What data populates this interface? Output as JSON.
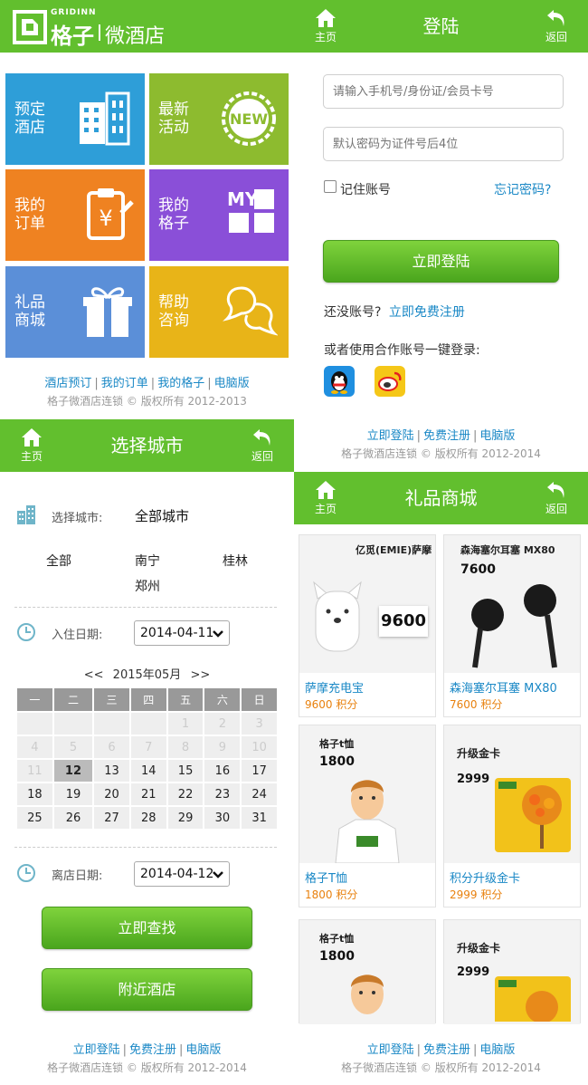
{
  "brand": {
    "logo_en": "GRIDINN",
    "logo_cn": "格子",
    "subtitle": "微酒店"
  },
  "colors": {
    "header": "#62bf2e",
    "link": "#1a88c6",
    "price": "#e8810e"
  },
  "home": {
    "tiles": [
      {
        "label": "预定酒店",
        "color": "#2e9ed8",
        "icon": "hotel-building-icon"
      },
      {
        "label": "最新活动",
        "color": "#8dbb2f",
        "icon": "new-badge-icon",
        "icon_text": "NEW"
      },
      {
        "label": "我的订单",
        "color": "#ef8221",
        "icon": "order-clipboard-icon"
      },
      {
        "label": "我的格子",
        "color": "#8a4fd8",
        "icon": "my-grid-icon",
        "icon_text": "MY"
      },
      {
        "label": "礼品商城",
        "color": "#5b8fd8",
        "icon": "gift-icon"
      },
      {
        "label": "帮助咨询",
        "color": "#e8b418",
        "icon": "chat-bubbles-icon"
      }
    ],
    "links": [
      "酒店预订",
      "我的订单",
      "我的格子",
      "电脑版"
    ],
    "copyright": "格子微酒店连锁 © 版权所有 2012-2013"
  },
  "login": {
    "nav": {
      "home": "主页",
      "title": "登陆",
      "back": "返回"
    },
    "username_placeholder": "请输入手机号/身份证/会员卡号",
    "password_placeholder": "默认密码为证件号后4位",
    "remember": "记住账号",
    "forgot": "忘记密码?",
    "submit": "立即登陆",
    "no_account": "还没账号?",
    "register": "立即免费注册",
    "partner": "或者使用合作账号一键登录:",
    "links": [
      "立即登陆",
      "免费注册",
      "电脑版"
    ],
    "copyright": "格子微酒店连锁 © 版权所有 2012-2014"
  },
  "city": {
    "nav": {
      "home": "主页",
      "title": "选择城市",
      "back": "返回"
    },
    "select_label": "选择城市:",
    "selected": "全部城市",
    "options": [
      "全部",
      "南宁",
      "桂林",
      "郑州"
    ],
    "checkin_label": "入住日期:",
    "checkin": "2014-04-11",
    "month": "2015年05月",
    "prev": "<<",
    "next": ">>",
    "weekdays": [
      "一",
      "二",
      "三",
      "四",
      "五",
      "六",
      "日"
    ],
    "weeks": [
      [
        "",
        "",
        "",
        "",
        "1",
        "2",
        "3"
      ],
      [
        "4",
        "5",
        "6",
        "7",
        "8",
        "9",
        "10"
      ],
      [
        "11",
        "12",
        "13",
        "14",
        "15",
        "16",
        "17"
      ],
      [
        "18",
        "19",
        "20",
        "21",
        "22",
        "23",
        "24"
      ],
      [
        "25",
        "26",
        "27",
        "28",
        "29",
        "30",
        "31"
      ]
    ],
    "today": "12",
    "checkout_label": "离店日期:",
    "checkout": "2014-04-12",
    "search": "立即查找",
    "nearby": "附近酒店",
    "links": [
      "立即登陆",
      "免费注册",
      "电脑版"
    ],
    "copyright": "格子微酒店连锁 © 版权所有 2012-2014"
  },
  "mall": {
    "nav": {
      "home": "主页",
      "title": "礼品商城",
      "back": "返回"
    },
    "products": [
      {
        "name": "萨摩充电宝",
        "price": "9600 积分",
        "img_brand": "亿觅(EMIE)萨摩",
        "img_price": "9600"
      },
      {
        "name": "森海塞尔耳塞 MX80",
        "price": "7600 积分",
        "img_brand": "森海塞尔耳塞 MX80",
        "img_price": "7600"
      },
      {
        "name": "格子T恤",
        "price": "1800 积分",
        "img_brand": "格子t恤",
        "img_price": "1800"
      },
      {
        "name": "积分升级金卡",
        "price": "2999 积分",
        "img_brand": "升级金卡",
        "img_price": "2999"
      },
      {
        "name": "",
        "price": "",
        "img_brand": "格子t恤",
        "img_price": "1800"
      },
      {
        "name": "",
        "price": "",
        "img_brand": "升级金卡",
        "img_price": "2999"
      }
    ],
    "links": [
      "立即登陆",
      "免费注册",
      "电脑版"
    ],
    "copyright": "格子微酒店连锁 © 版权所有 2012-2014"
  }
}
